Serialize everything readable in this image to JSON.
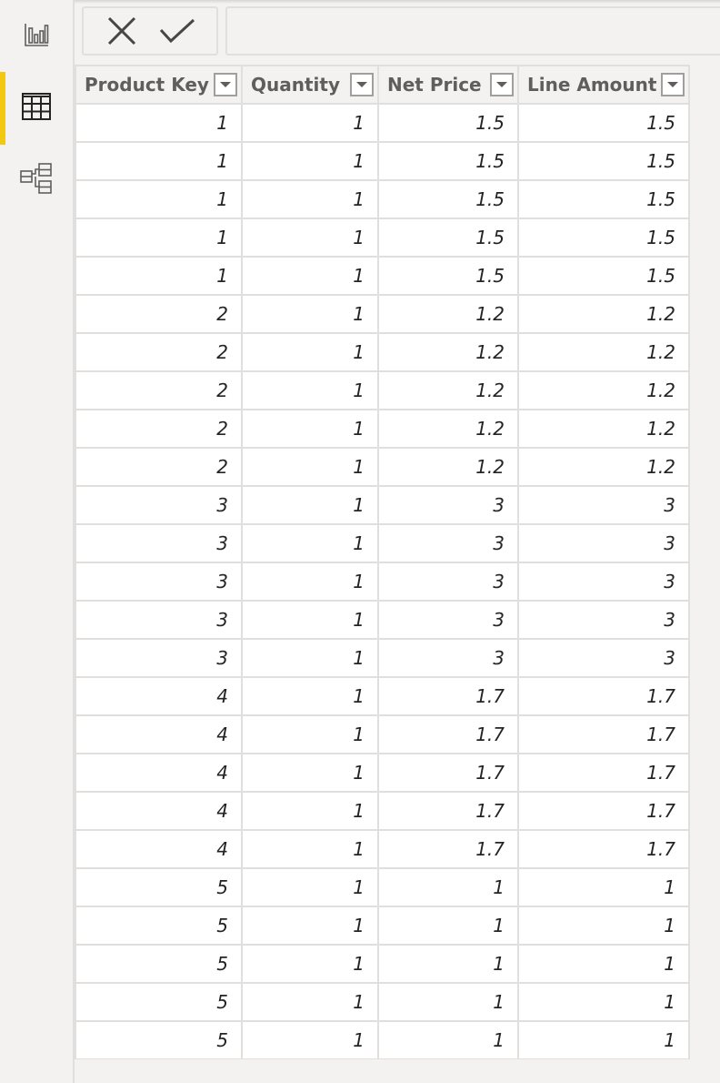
{
  "sidebar": {
    "items": [
      {
        "name": "report-view",
        "icon": "bar-chart-icon",
        "active": false
      },
      {
        "name": "data-view",
        "icon": "table-grid-icon",
        "active": true
      },
      {
        "name": "model-view",
        "icon": "model-diagram-icon",
        "active": false
      }
    ],
    "accent_color": "#f2c811"
  },
  "formula_bar": {
    "cancel_icon": "close-icon",
    "commit_icon": "checkmark-icon",
    "value": ""
  },
  "table": {
    "columns": [
      "Product Key",
      "Quantity",
      "Net Price",
      "Line Amount"
    ],
    "rows": [
      [
        "1",
        "1",
        "1.5",
        "1.5"
      ],
      [
        "1",
        "1",
        "1.5",
        "1.5"
      ],
      [
        "1",
        "1",
        "1.5",
        "1.5"
      ],
      [
        "1",
        "1",
        "1.5",
        "1.5"
      ],
      [
        "1",
        "1",
        "1.5",
        "1.5"
      ],
      [
        "2",
        "1",
        "1.2",
        "1.2"
      ],
      [
        "2",
        "1",
        "1.2",
        "1.2"
      ],
      [
        "2",
        "1",
        "1.2",
        "1.2"
      ],
      [
        "2",
        "1",
        "1.2",
        "1.2"
      ],
      [
        "2",
        "1",
        "1.2",
        "1.2"
      ],
      [
        "3",
        "1",
        "3",
        "3"
      ],
      [
        "3",
        "1",
        "3",
        "3"
      ],
      [
        "3",
        "1",
        "3",
        "3"
      ],
      [
        "3",
        "1",
        "3",
        "3"
      ],
      [
        "3",
        "1",
        "3",
        "3"
      ],
      [
        "4",
        "1",
        "1.7",
        "1.7"
      ],
      [
        "4",
        "1",
        "1.7",
        "1.7"
      ],
      [
        "4",
        "1",
        "1.7",
        "1.7"
      ],
      [
        "4",
        "1",
        "1.7",
        "1.7"
      ],
      [
        "4",
        "1",
        "1.7",
        "1.7"
      ],
      [
        "5",
        "1",
        "1",
        "1"
      ],
      [
        "5",
        "1",
        "1",
        "1"
      ],
      [
        "5",
        "1",
        "1",
        "1"
      ],
      [
        "5",
        "1",
        "1",
        "1"
      ],
      [
        "5",
        "1",
        "1",
        "1"
      ]
    ]
  }
}
